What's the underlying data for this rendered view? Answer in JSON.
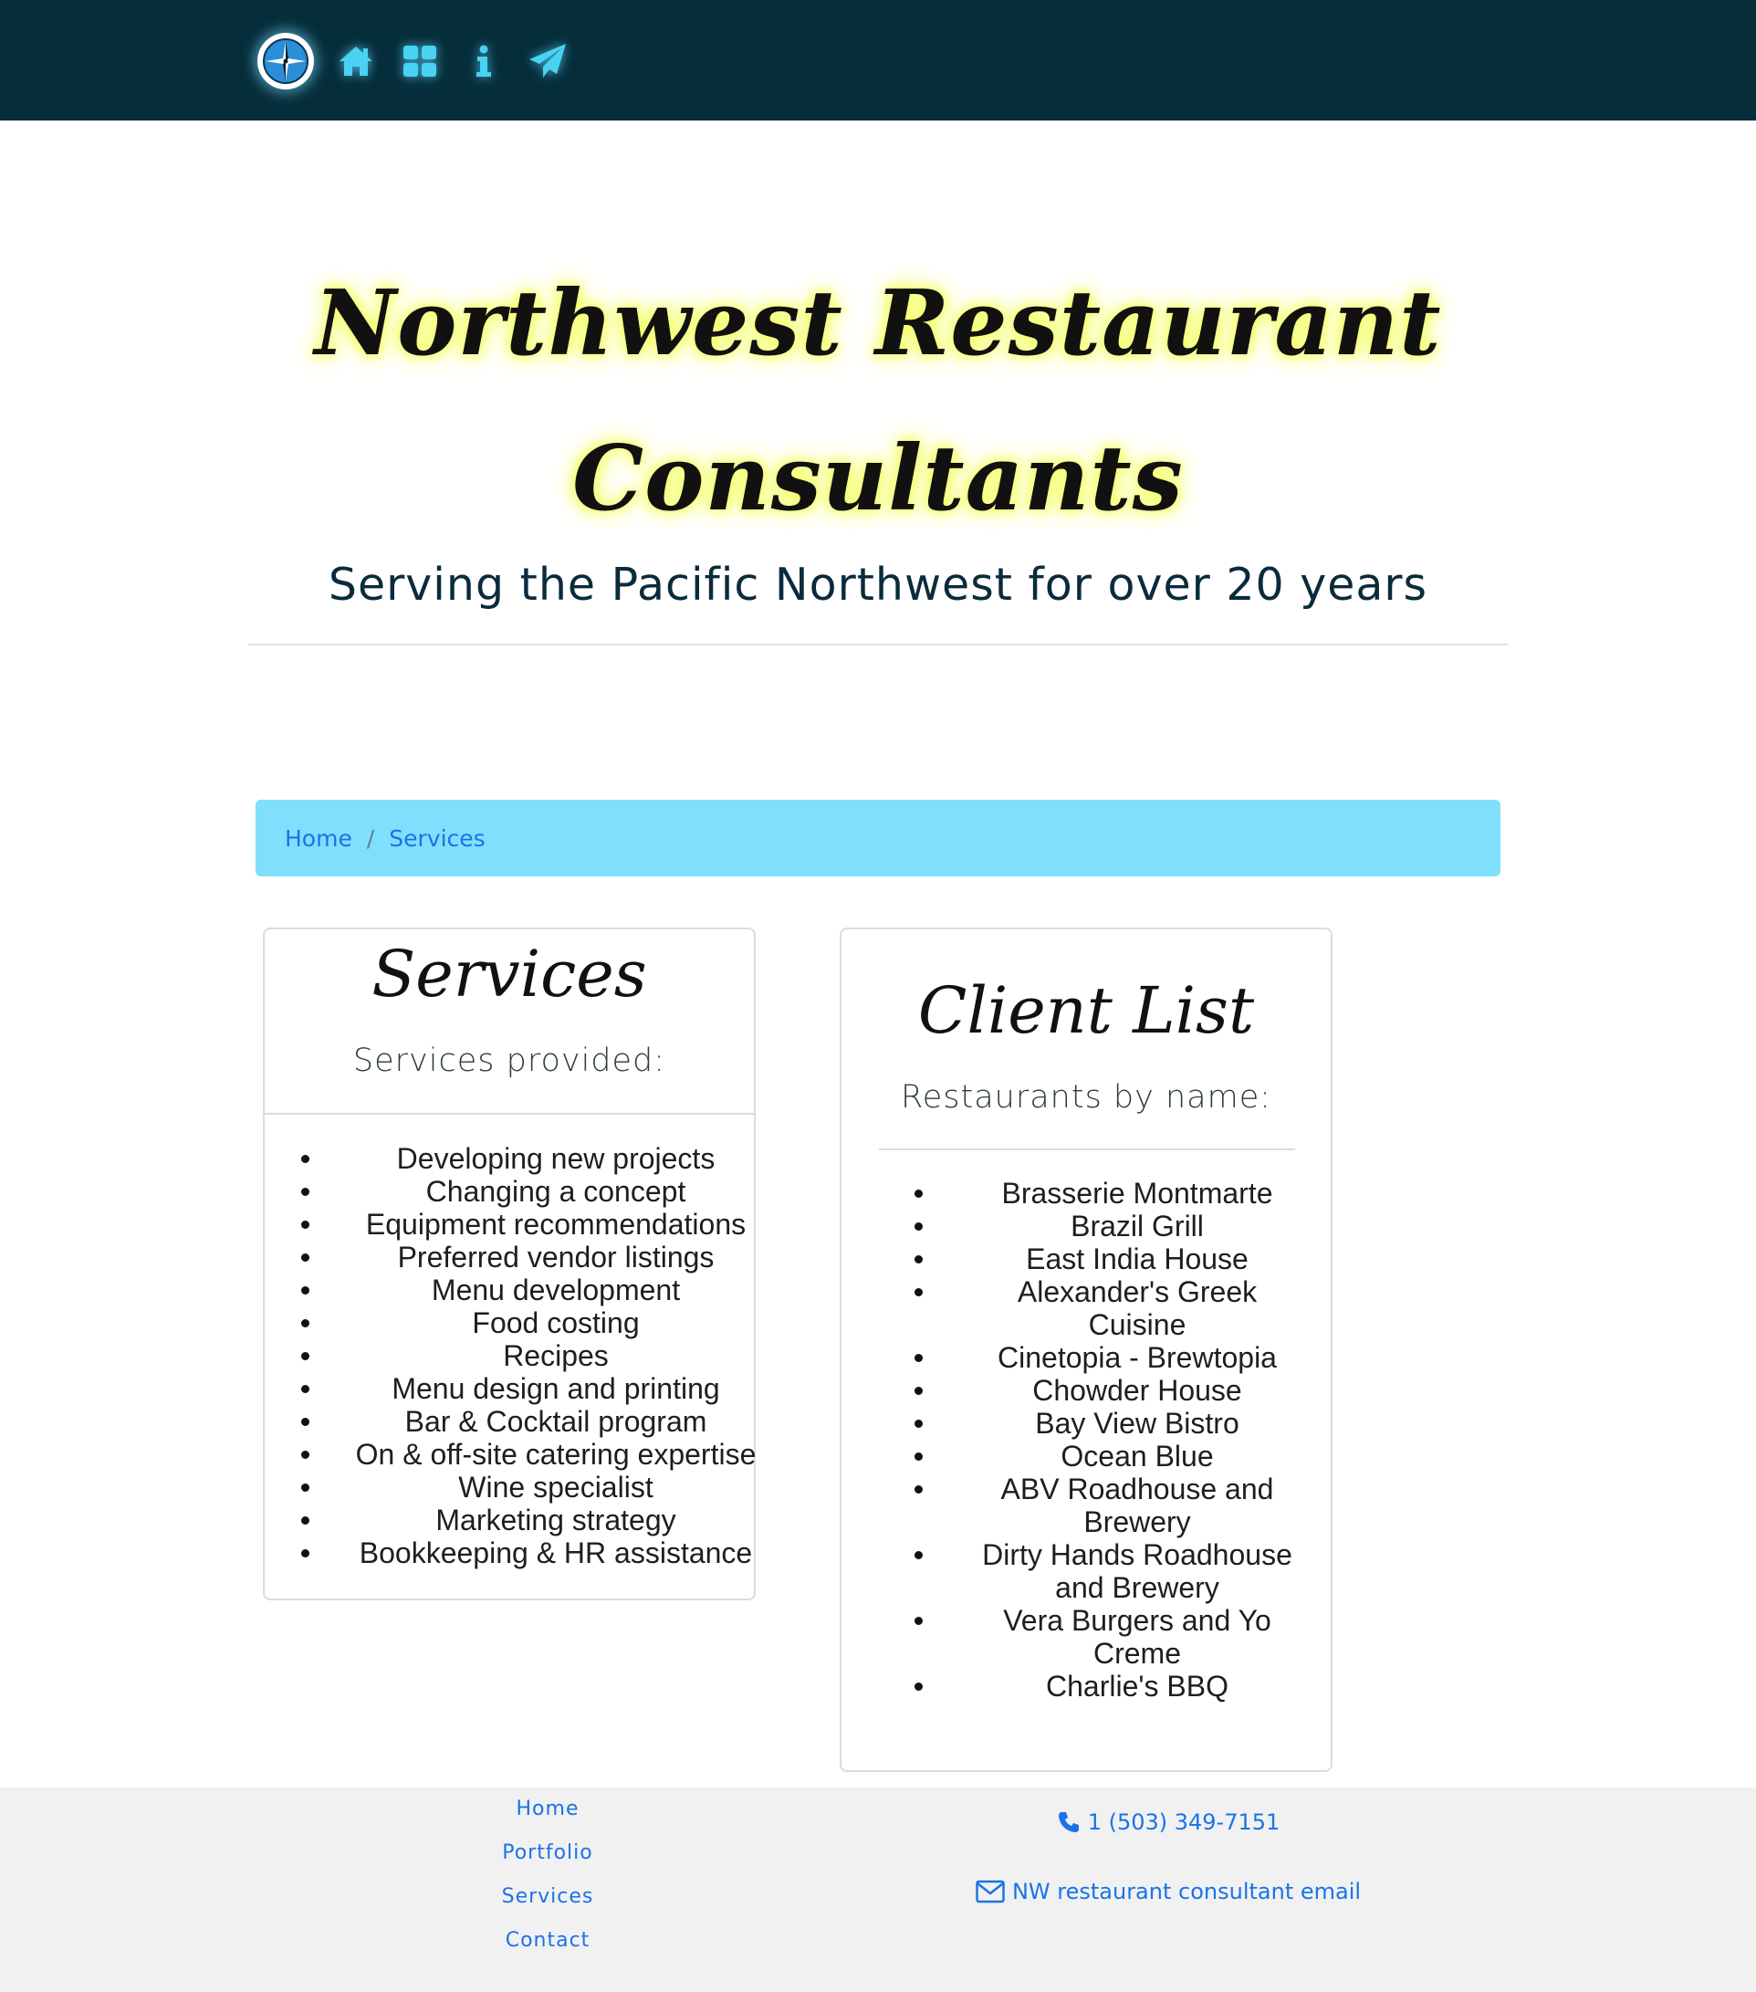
{
  "nav": {
    "logo": "compass-logo",
    "icons": [
      "home-icon",
      "grid-icon",
      "info-icon",
      "paper-plane-icon"
    ]
  },
  "hero": {
    "title_line1": "Northwest Restaurant",
    "title_line2": "Consultants",
    "tagline": "Serving the Pacific Northwest for over 20 years"
  },
  "breadcrumb": {
    "home": "Home",
    "separator": "/",
    "current": "Services"
  },
  "services_card": {
    "title": "Services",
    "subtitle": "Services provided:",
    "items": [
      "Developing new projects",
      "Changing a concept",
      "Equipment recommendations",
      "Preferred vendor listings",
      "Menu development",
      "Food costing",
      "Recipes",
      "Menu design and printing",
      "Bar & Cocktail program",
      "On & off-site catering expertise",
      "Wine specialist",
      "Marketing strategy",
      "Bookkeeping & HR assistance"
    ]
  },
  "clients_card": {
    "title": "Client List",
    "subtitle": "Restaurants by name:",
    "items": [
      "Brasserie Montmarte",
      "Brazil Grill",
      "East India House",
      "Alexander's Greek Cuisine",
      "Cinetopia - Brewtopia",
      "Chowder House",
      "Bay View Bistro",
      "Ocean Blue",
      "ABV Roadhouse and Brewery",
      "Dirty Hands Roadhouse and Brewery",
      "Vera Burgers and Yo Creme",
      "Charlie's BBQ"
    ]
  },
  "footer": {
    "links": [
      "Home",
      "Portfolio",
      "Services",
      "Contact"
    ],
    "phone": "1 (503) 349-7151",
    "email_label": "NW restaurant consultant email"
  },
  "colors": {
    "navbar": "#062d3a",
    "nav_icon": "#49d2f2",
    "breadcrumb_bg": "#80dffc",
    "link": "#1a73e8",
    "title_glow": "#f4ff5c",
    "footer_bg": "#f1f1f1"
  }
}
